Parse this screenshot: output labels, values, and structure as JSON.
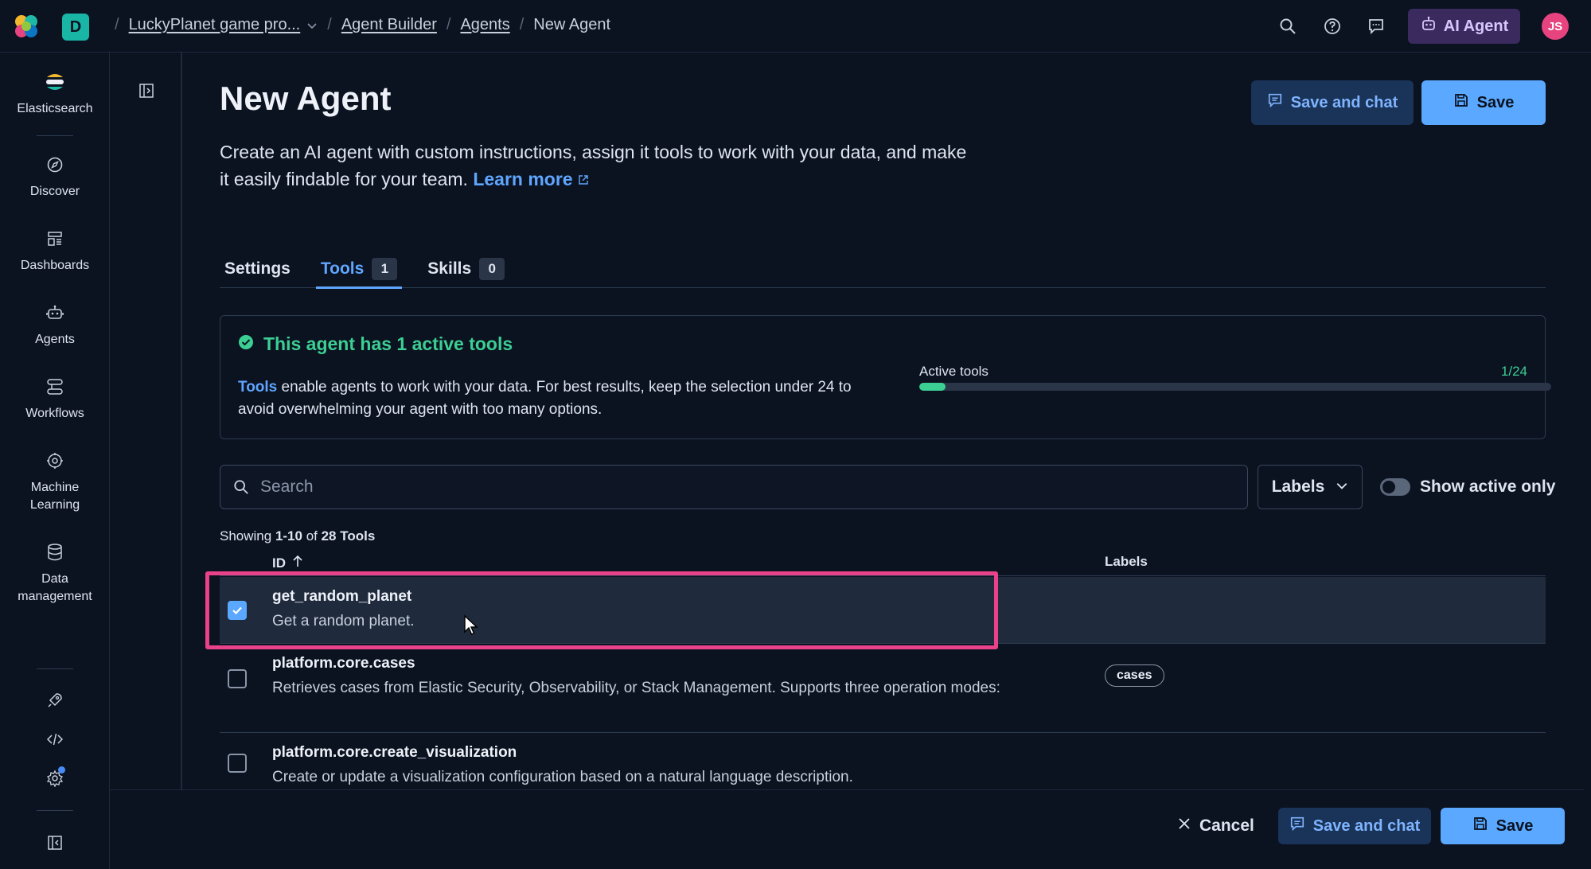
{
  "header": {
    "space_initial": "D",
    "breadcrumbs": {
      "project": "LuckyPlanet game pro...",
      "agent_builder": "Agent Builder",
      "agents": "Agents",
      "current": "New Agent"
    },
    "ai_agent_label": "AI Agent",
    "avatar_initials": "JS"
  },
  "nav": {
    "items": [
      {
        "label": "Elasticsearch",
        "icon": "elasticsearch-logo-icon"
      },
      {
        "label": "Discover",
        "icon": "compass-icon"
      },
      {
        "label": "Dashboards",
        "icon": "dashboard-icon"
      },
      {
        "label": "Agents",
        "icon": "robot-icon"
      },
      {
        "label": "Workflows",
        "icon": "workflow-icon"
      },
      {
        "label": "Machine Learning",
        "icon": "brain-icon"
      },
      {
        "label": "Data management",
        "icon": "database-icon"
      }
    ]
  },
  "page": {
    "title": "New Agent",
    "description": "Create an AI agent with custom instructions, assign it tools to work with your data, and make it easily findable for your team.",
    "learn_more": "Learn more",
    "save_and_chat": "Save and chat",
    "save": "Save"
  },
  "tabs": [
    {
      "label": "Settings",
      "count": null,
      "active": false
    },
    {
      "label": "Tools",
      "count": "1",
      "active": true
    },
    {
      "label": "Skills",
      "count": "0",
      "active": false
    }
  ],
  "info": {
    "title": "This agent has 1 active tools",
    "text_link": "Tools",
    "text_rest": " enable agents to work with your data. For best results, keep the selection under 24 to avoid overwhelming your agent with too many options.",
    "progress_label": "Active tools",
    "progress_count": "1/24",
    "progress_fraction": 0.0417
  },
  "filters": {
    "search_placeholder": "Search",
    "labels_button": "Labels",
    "toggle_label": "Show active only",
    "toggle_on": false
  },
  "table": {
    "showing_prefix": "Showing ",
    "showing_range": "1-10",
    "showing_mid": " of ",
    "showing_total": "28",
    "showing_suffix": "Tools",
    "col_id": "ID",
    "col_labels": "Labels",
    "rows": [
      {
        "id": "get_random_planet",
        "desc": "Get a random planet.",
        "checked": true,
        "label": null
      },
      {
        "id": "platform.core.cases",
        "desc": "Retrieves cases from Elastic Security, Observability, or Stack Management. Supports three operation modes:",
        "checked": false,
        "label": "cases"
      },
      {
        "id": "platform.core.create_visualization",
        "desc": "Create or update a visualization configuration based on a natural language description.",
        "checked": false,
        "label": null
      }
    ]
  },
  "footer": {
    "cancel": "Cancel",
    "save_and_chat": "Save and chat",
    "save": "Save"
  },
  "colors": {
    "accent": "#5aa8ff",
    "success": "#3ccf93",
    "highlight": "#e9428a",
    "ai_agent_bg": "#3a2a5e"
  }
}
